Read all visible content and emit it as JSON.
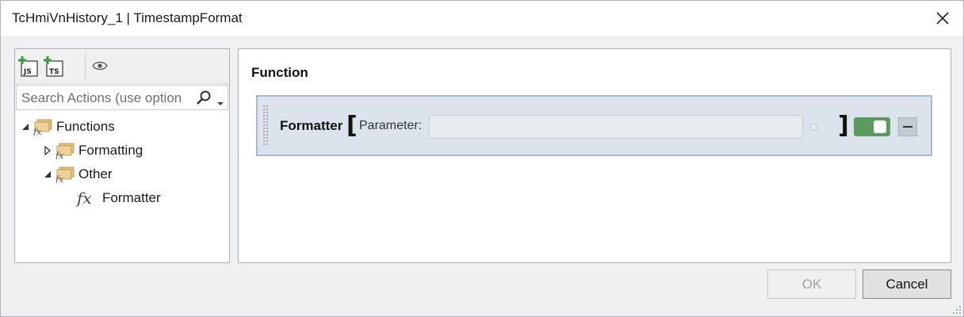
{
  "window": {
    "title": "TcHmiVnHistory_1 | TimestampFormat"
  },
  "toolbar": {
    "buttons": [
      {
        "icon": "add-javascript-icon",
        "label": "JS"
      },
      {
        "icon": "add-typescript-icon",
        "label": "TS"
      },
      {
        "icon": "eye-icon"
      }
    ]
  },
  "search": {
    "placeholder": "Search Actions (use option"
  },
  "tree": {
    "items": [
      {
        "label": "Functions",
        "expanded": true,
        "icon": "fx-folder-icon"
      },
      {
        "label": "Formatting",
        "expanded": false,
        "icon": "fx-folder-icon"
      },
      {
        "label": "Other",
        "expanded": true,
        "icon": "fx-folder-icon"
      },
      {
        "label": "Formatter",
        "icon": "fx-function-icon"
      }
    ]
  },
  "main": {
    "section_title": "Function",
    "function_block": {
      "name": "Formatter",
      "open_bracket": "[",
      "close_bracket": "]",
      "parameter_label": "Parameter:",
      "parameter_value": "",
      "enabled": true
    }
  },
  "footer": {
    "ok_label": "OK",
    "cancel_label": "Cancel"
  },
  "colors": {
    "toggle_on": "#5b9b5e",
    "function_block_bg": "#dde3ec",
    "function_block_border": "#a9b9cf"
  }
}
